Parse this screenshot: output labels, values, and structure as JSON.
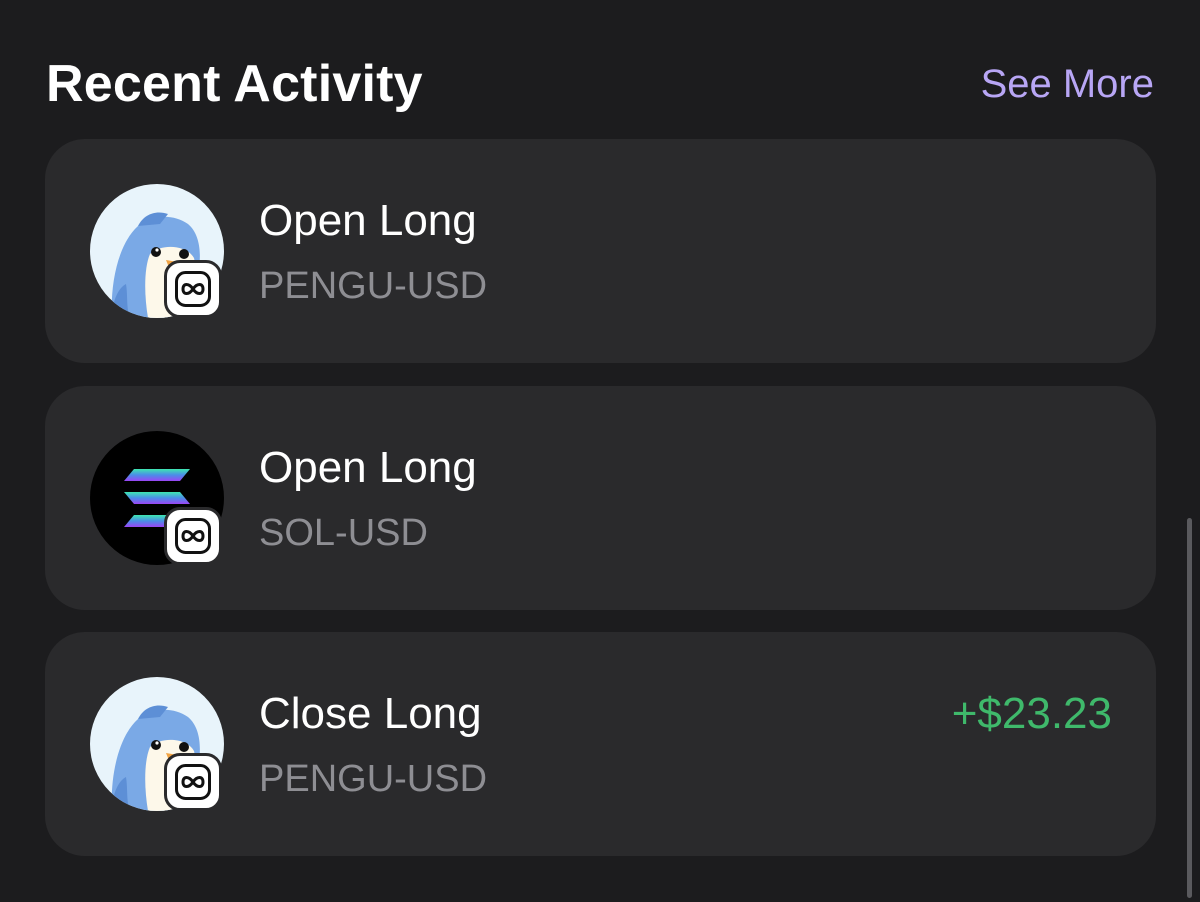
{
  "header": {
    "title": "Recent Activity",
    "see_more_label": "See More"
  },
  "activities": [
    {
      "action": "Open Long",
      "pair": "PENGU-USD",
      "token_icon": "pengu-icon",
      "badge_icon": "infinity-icon",
      "amount": ""
    },
    {
      "action": "Open Long",
      "pair": "SOL-USD",
      "token_icon": "solana-icon",
      "badge_icon": "infinity-icon",
      "amount": ""
    },
    {
      "action": "Close Long",
      "pair": "PENGU-USD",
      "token_icon": "pengu-icon",
      "badge_icon": "infinity-icon",
      "amount": "+$23.23"
    }
  ],
  "colors": {
    "background": "#1c1c1e",
    "card": "#2a2a2c",
    "accent": "#b8a6f5",
    "positive": "#3fb96b",
    "secondary_text": "#8e8e93"
  }
}
